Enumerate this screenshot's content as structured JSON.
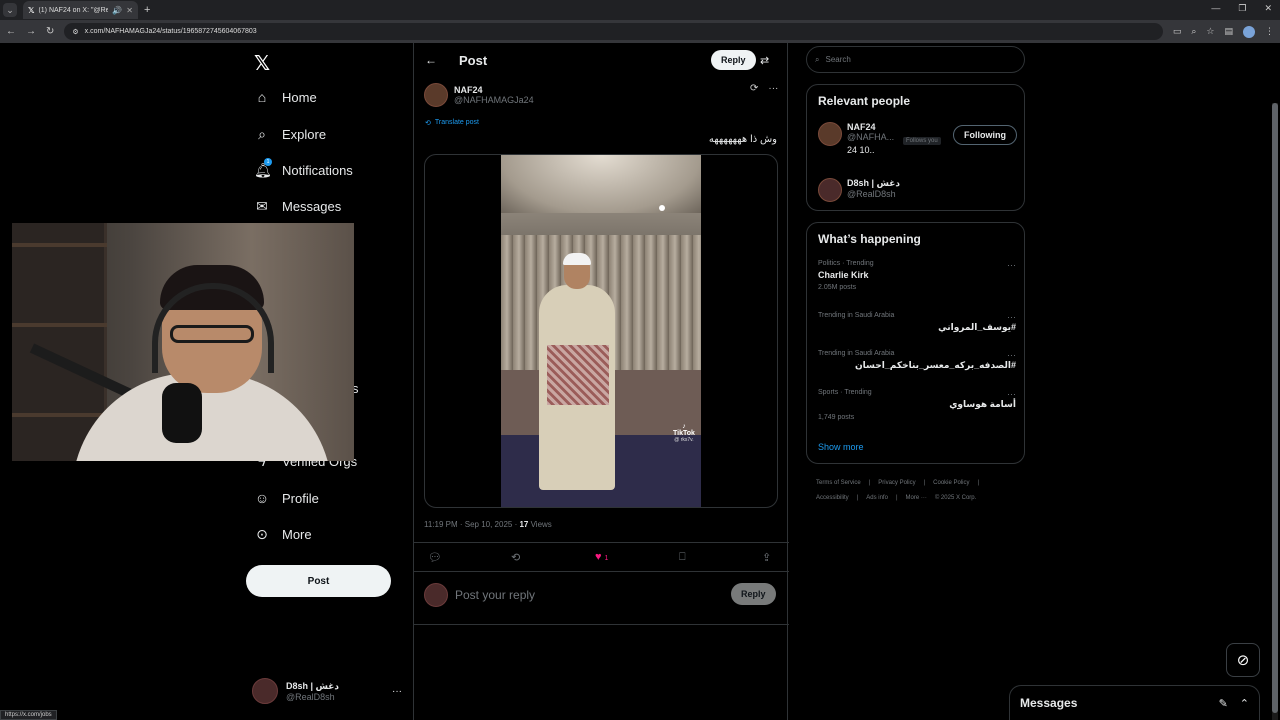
{
  "browser": {
    "tab_title": "(1) NAF24 on X: \"@RealD8...",
    "url": "x.com/NAFHAMAGJa24/status/1965872745604067803",
    "status_url": "https://x.com/jobs"
  },
  "nav": {
    "items": [
      {
        "label": "Home",
        "icon": "home-icon"
      },
      {
        "label": "Explore",
        "icon": "search-icon"
      },
      {
        "label": "Notifications",
        "icon": "bell-icon"
      },
      {
        "label": "Messages",
        "icon": "mail-icon"
      },
      {
        "label": "s",
        "icon": ""
      },
      {
        "label": "Verified Orgs",
        "icon": "lightning-icon"
      },
      {
        "label": "Profile",
        "icon": "person-icon"
      },
      {
        "label": "More",
        "icon": "more-circle-icon"
      }
    ],
    "post_label": "Post",
    "me": {
      "name": "D8sh | دغش",
      "handle": "@RealD8sh"
    }
  },
  "post": {
    "header_title": "Post",
    "reply_top_label": "Reply",
    "author_name": "NAF24",
    "author_handle": "@NAFHAMAGJa24",
    "translate_label": "Translate post",
    "text": "وش ذا هههههههه",
    "tiktok_label": "TikTok",
    "tiktok_sub": "@ rks7v.",
    "time": "11:19 PM · Sep 10, 2025 · ",
    "views_count": "17",
    "views_label": " Views",
    "likes": "1",
    "reply_placeholder": "Post your reply",
    "reply_button": "Reply"
  },
  "right": {
    "search_placeholder": "Search",
    "relevant_title": "Relevant people",
    "people": [
      {
        "name": "NAF24",
        "handle": "@NAFHA...",
        "follows_you": "Follows you",
        "bio": "24 10..",
        "button": "Following"
      },
      {
        "name": "D8sh | دغش",
        "handle": "@RealD8sh"
      }
    ],
    "happening_title": "What’s happening",
    "trends": [
      {
        "context": "Politics · Trending",
        "title": "Charlie Kirk",
        "count": "2.05M posts"
      },
      {
        "context": "Trending in Saudi Arabia",
        "title": "#يوسف_المرواني",
        "count": ""
      },
      {
        "context": "Trending in Saudi Arabia",
        "title": "#الصدفه_بركه_معسر_بناخكم_احسان",
        "count": ""
      },
      {
        "context": "Sports · Trending",
        "title": "أسامة هوساوي",
        "count": "1,749 posts"
      }
    ],
    "show_more": "Show more",
    "footer": [
      "Terms of Service",
      "|",
      "Privacy Policy",
      "|",
      "Cookie Policy",
      "|",
      "Accessibility",
      "|",
      "Ads info",
      "|",
      "More ···",
      "© 2025 X Corp."
    ]
  },
  "messages_drawer": {
    "title": "Messages"
  }
}
